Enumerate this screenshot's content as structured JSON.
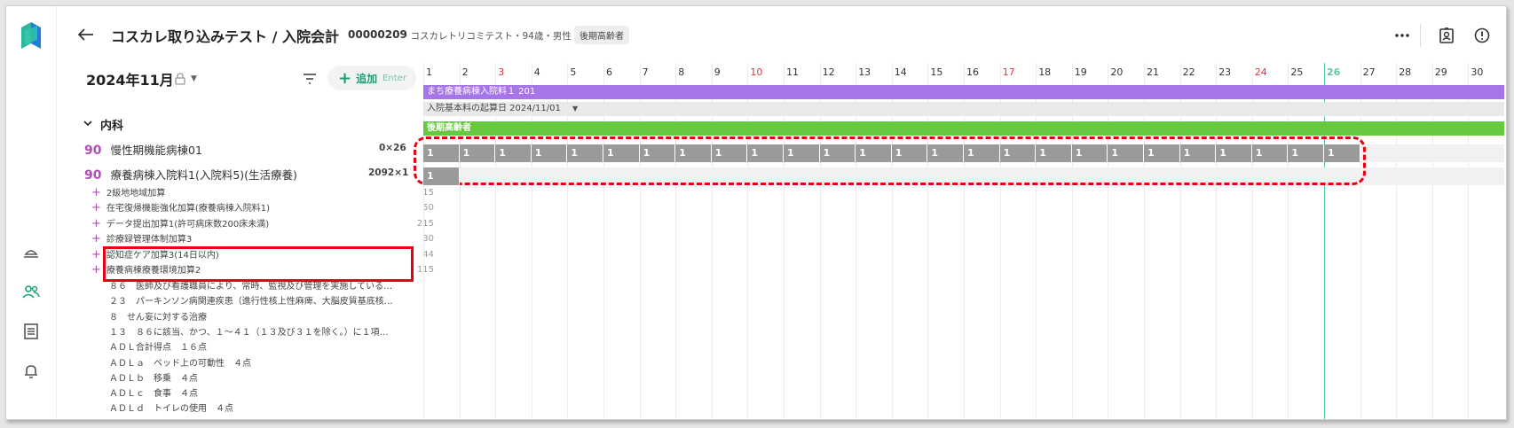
{
  "header": {
    "title": "コスカレ取り込みテスト / 入院会計",
    "patient_id": "00000209",
    "patient_info": "・コスカレトリコミテスト・94歳・男性",
    "badge": "後期高齢者"
  },
  "toolbar": {
    "month": "2024年11月",
    "add_label": "追加",
    "add_hint": "Enter"
  },
  "left": {
    "group": "内科",
    "main_items": [
      {
        "num": "90",
        "label": "慢性期機能病棟01",
        "qty": "0×26"
      },
      {
        "num": "90",
        "label": "療養病棟入院料1(入院料5)(生活療養)",
        "qty": "2092×1"
      }
    ],
    "sub_items": [
      {
        "label": "2級地地域加算",
        "value": "15"
      },
      {
        "label": "在宅復帰機能強化加算(療養病棟入院料1)",
        "value": "50"
      },
      {
        "label": "データ提出加算1(許可病床数200床未満)",
        "value": "215"
      },
      {
        "label": "診療録管理体制加算3",
        "value": "30"
      },
      {
        "label": "認知症ケア加算3(14日以内)",
        "value": "44"
      },
      {
        "label": "療養病棟療養環境加算2",
        "value": "115"
      }
    ],
    "notes": [
      "８６　医師及び看護職員により、常時、監視及び管理を実施している…",
      "２３　パーキンソン病関連疾患（進行性核上性麻痺、大脳皮質基底核…",
      "８　せん妄に対する治療",
      "１３　８６に該当、かつ、１〜４１（１３及び３１を除く。）に１項…",
      "ＡＤＬ合計得点　１６点",
      "ＡＤＬａ　ベッド上の可動性　４点",
      "ＡＤＬｂ　移乗　４点",
      "ＡＤＬｃ　食事　４点",
      "ＡＤＬｄ　トイレの使用　４点"
    ]
  },
  "calendar": {
    "days": [
      "1",
      "2",
      "3",
      "4",
      "5",
      "6",
      "7",
      "8",
      "9",
      "10",
      "11",
      "12",
      "13",
      "14",
      "15",
      "16",
      "17",
      "18",
      "19",
      "20",
      "21",
      "22",
      "23",
      "24",
      "25",
      "26",
      "27",
      "28",
      "29",
      "30"
    ],
    "red_days": [
      3,
      10,
      17,
      24
    ],
    "today": 26,
    "ward_bar": "まち療養病棟入院料１ 201",
    "start_bar": "入院基本料の起算日 2024/11/01",
    "insurance_bar": "後期高齢者",
    "row1_cell": "1",
    "row1_count": 26,
    "row2_cell": "1",
    "row2_count": 1,
    "colors": {
      "ward": "#a675e8",
      "insurance": "#66c93f",
      "cell": "#9a9a9a",
      "today": "#59c7a6",
      "red": "#e0333a"
    }
  }
}
